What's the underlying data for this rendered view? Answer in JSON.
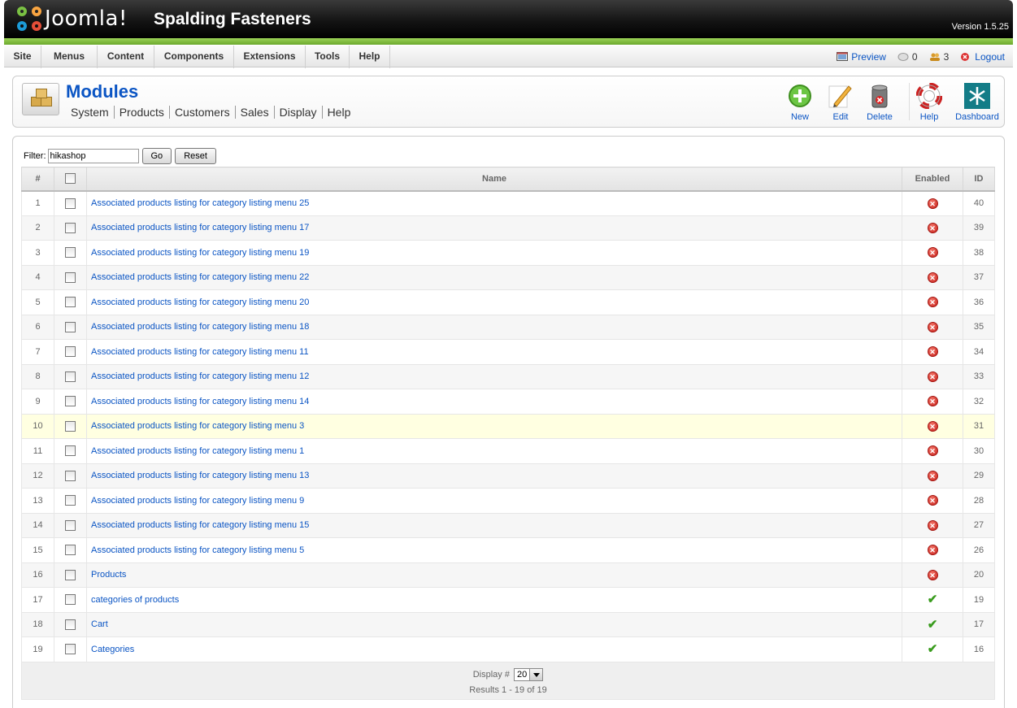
{
  "header": {
    "logo_text": "Joomla!",
    "site_name": "Spalding Fasteners",
    "version": "Version 1.5.25"
  },
  "menu": {
    "items": [
      "Site",
      "Menus",
      "Content",
      "Components",
      "Extensions",
      "Tools",
      "Help"
    ],
    "preview_label": "Preview",
    "messages_count": "0",
    "users_count": "3",
    "logout_label": "Logout"
  },
  "toolbar": {
    "title": "Modules",
    "submenu": [
      "System",
      "Products",
      "Customers",
      "Sales",
      "Display",
      "Help"
    ],
    "buttons": {
      "new": "New",
      "edit": "Edit",
      "delete": "Delete",
      "help": "Help",
      "dashboard": "Dashboard"
    }
  },
  "filter": {
    "label": "Filter:",
    "value": "hikashop",
    "go_label": "Go",
    "reset_label": "Reset"
  },
  "table": {
    "headers": {
      "num": "#",
      "name": "Name",
      "enabled": "Enabled",
      "id": "ID"
    },
    "rows": [
      {
        "num": "1",
        "name": "Associated products listing for category listing menu 25",
        "enabled": false,
        "id": "40"
      },
      {
        "num": "2",
        "name": "Associated products listing for category listing menu 17",
        "enabled": false,
        "id": "39"
      },
      {
        "num": "3",
        "name": "Associated products listing for category listing menu 19",
        "enabled": false,
        "id": "38"
      },
      {
        "num": "4",
        "name": "Associated products listing for category listing menu 22",
        "enabled": false,
        "id": "37"
      },
      {
        "num": "5",
        "name": "Associated products listing for category listing menu 20",
        "enabled": false,
        "id": "36"
      },
      {
        "num": "6",
        "name": "Associated products listing for category listing menu 18",
        "enabled": false,
        "id": "35"
      },
      {
        "num": "7",
        "name": "Associated products listing for category listing menu 11",
        "enabled": false,
        "id": "34"
      },
      {
        "num": "8",
        "name": "Associated products listing for category listing menu 12",
        "enabled": false,
        "id": "33"
      },
      {
        "num": "9",
        "name": "Associated products listing for category listing menu 14",
        "enabled": false,
        "id": "32"
      },
      {
        "num": "10",
        "name": "Associated products listing for category listing menu 3",
        "enabled": false,
        "id": "31"
      },
      {
        "num": "11",
        "name": "Associated products listing for category listing menu 1",
        "enabled": false,
        "id": "30"
      },
      {
        "num": "12",
        "name": "Associated products listing for category listing menu 13",
        "enabled": false,
        "id": "29"
      },
      {
        "num": "13",
        "name": "Associated products listing for category listing menu 9",
        "enabled": false,
        "id": "28"
      },
      {
        "num": "14",
        "name": "Associated products listing for category listing menu 15",
        "enabled": false,
        "id": "27"
      },
      {
        "num": "15",
        "name": "Associated products listing for category listing menu 5",
        "enabled": false,
        "id": "26"
      },
      {
        "num": "16",
        "name": "Products",
        "enabled": false,
        "id": "20"
      },
      {
        "num": "17",
        "name": "categories of products",
        "enabled": true,
        "id": "19"
      },
      {
        "num": "18",
        "name": "Cart",
        "enabled": true,
        "id": "17"
      },
      {
        "num": "19",
        "name": "Categories",
        "enabled": true,
        "id": "16"
      }
    ],
    "highlighted_row": "10"
  },
  "pagination": {
    "display_label": "Display #",
    "display_value": "20",
    "results_text": "Results 1 - 19 of 19"
  },
  "colors": {
    "link": "#0b55c4",
    "header_bg": "#000000",
    "accent_green": "#7ac143",
    "disabled_red": "#c6201a",
    "enabled_green": "#3a9c1e"
  }
}
